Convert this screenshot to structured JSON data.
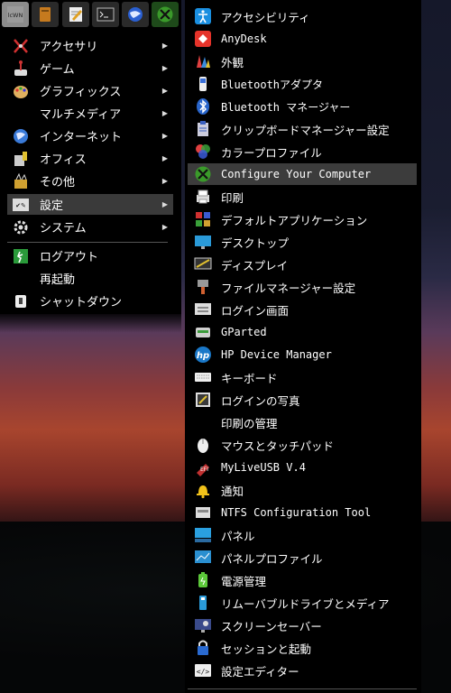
{
  "quick_launch": [
    {
      "name": "lcowin-icon",
      "text": "lcWN"
    },
    {
      "name": "file-manager-icon",
      "text": ""
    },
    {
      "name": "text-editor-icon",
      "text": ""
    },
    {
      "name": "terminal-icon",
      "text": ""
    },
    {
      "name": "web-browser-icon",
      "text": ""
    },
    {
      "name": "settings-tool-icon",
      "text": ""
    }
  ],
  "main_menu": {
    "items": [
      {
        "label": "アクセサリ",
        "icon": "accessories-icon",
        "submenu": true
      },
      {
        "label": "ゲーム",
        "icon": "games-icon",
        "submenu": true
      },
      {
        "label": "グラフィックス",
        "icon": "graphics-icon",
        "submenu": true
      },
      {
        "label": "マルチメディア",
        "icon": "",
        "submenu": true
      },
      {
        "label": "インターネット",
        "icon": "internet-icon",
        "submenu": true
      },
      {
        "label": "オフィス",
        "icon": "office-icon",
        "submenu": true
      },
      {
        "label": "その他",
        "icon": "other-icon",
        "submenu": true
      },
      {
        "label": "設定",
        "icon": "settings-icon",
        "submenu": true,
        "selected": true
      },
      {
        "label": "システム",
        "icon": "system-icon",
        "submenu": true
      }
    ],
    "session": [
      {
        "label": "ログアウト",
        "icon": "logout-icon"
      },
      {
        "label": "再起動",
        "icon": ""
      },
      {
        "label": "シャットダウン",
        "icon": "shutdown-icon"
      }
    ],
    "arrow_glyph": "▶"
  },
  "settings_submenu": {
    "items": [
      {
        "label": "アクセシビリティ",
        "icon": "accessibility-icon",
        "color": "#1a8fe0"
      },
      {
        "label": "AnyDesk",
        "icon": "anydesk-icon",
        "color": "#e5332a",
        "mono": true
      },
      {
        "label": "外観",
        "icon": "appearance-icon",
        "color": "#d8a030"
      },
      {
        "label": "Bluetoothアダプタ",
        "icon": "bluetooth-adapter-icon",
        "color": "#3a6fd8",
        "mono": true
      },
      {
        "label": "Bluetooth マネージャー",
        "icon": "bluetooth-manager-icon",
        "color": "#2a66cc",
        "mono": true
      },
      {
        "label": "クリップボードマネージャー設定",
        "icon": "clipboard-icon",
        "color": "#3a5fbf"
      },
      {
        "label": "カラープロファイル",
        "icon": "color-profile-icon",
        "color": "#e04040"
      },
      {
        "label": "Configure Your Computer",
        "icon": "configure-computer-icon",
        "color": "#4aa33a",
        "mono": true,
        "selected": true
      },
      {
        "label": "印刷",
        "icon": "printer-icon",
        "color": "#dddddd"
      },
      {
        "label": "デフォルトアプリケーション",
        "icon": "default-apps-icon",
        "color": "#d03030"
      },
      {
        "label": "デスクトップ",
        "icon": "desktop-icon",
        "color": "#2a9ad8"
      },
      {
        "label": "ディスプレイ",
        "icon": "display-icon",
        "color": "#cccccc"
      },
      {
        "label": "ファイルマネージャー設定",
        "icon": "file-manager-settings-icon",
        "color": "#d06030"
      },
      {
        "label": "ログイン画面",
        "icon": "login-screen-icon",
        "color": "#cccccc"
      },
      {
        "label": "GParted",
        "icon": "gparted-icon",
        "color": "#cfcfcf",
        "mono": true
      },
      {
        "label": "HP Device Manager",
        "icon": "hp-icon",
        "color": "#1a78c8",
        "mono": true
      },
      {
        "label": "キーボード",
        "icon": "keyboard-icon",
        "color": "#dddddd"
      },
      {
        "label": "ログインの写真",
        "icon": "login-photo-icon",
        "color": "#cccccc"
      },
      {
        "label": "印刷の管理",
        "icon": "",
        "color": ""
      },
      {
        "label": "マウスとタッチパッド",
        "icon": "mouse-icon",
        "color": "#eeeeee"
      },
      {
        "label": "MyLiveUSB V.4",
        "icon": "myliveusb-icon",
        "color": "#c03030",
        "mono": true
      },
      {
        "label": "通知",
        "icon": "notification-bell-icon",
        "color": "#f2c21a"
      },
      {
        "label": "NTFS Configuration Tool",
        "icon": "ntfs-icon",
        "color": "#dddddd",
        "mono": true
      },
      {
        "label": "パネル",
        "icon": "panel-icon",
        "color": "#2aa0e0"
      },
      {
        "label": "パネルプロファイル",
        "icon": "panel-profile-icon",
        "color": "#2a8fd0"
      },
      {
        "label": "電源管理",
        "icon": "power-icon",
        "color": "#5cc83a"
      },
      {
        "label": "リムーバブルドライブとメディア",
        "icon": "removable-drive-icon",
        "color": "#2a9ad8"
      },
      {
        "label": "スクリーンセーバー",
        "icon": "screensaver-icon",
        "color": "#3a4a8a"
      },
      {
        "label": "セッションと起動",
        "icon": "session-startup-icon",
        "color": "#2a6ad0"
      },
      {
        "label": "設定エディター",
        "icon": "settings-editor-icon",
        "color": "#dddddd"
      }
    ]
  },
  "colors": {
    "menu_bg": "#000000",
    "selected_bg": "#3c3c3c",
    "separator": "#555555",
    "text": "#ffffff"
  }
}
